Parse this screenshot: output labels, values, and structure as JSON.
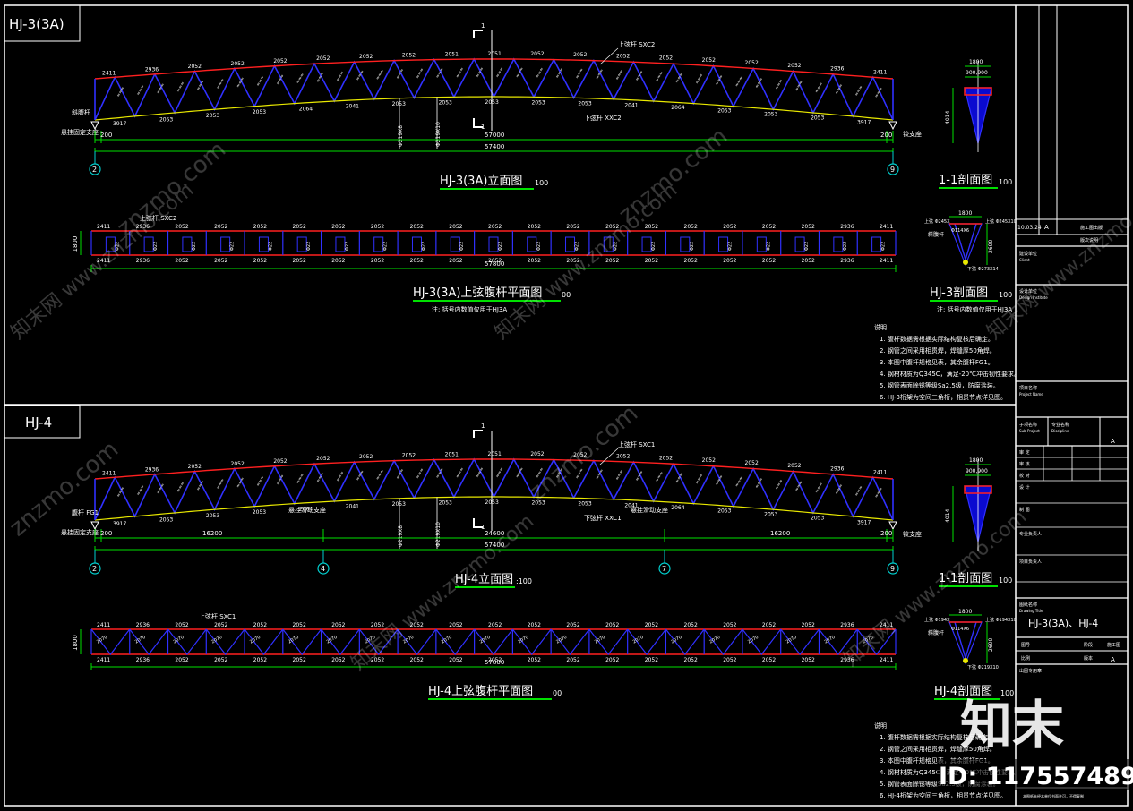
{
  "hj3": {
    "tag": "HJ-3(3A)",
    "elev_title": "HJ-3(3A)立面图",
    "elev_scale": "100",
    "plan_title": "HJ-3(3A)上弦腹杆平面图",
    "plan_scale": "00",
    "plan_note": "注: 括号内数值仅用于HJ3A",
    "sec_title": "1-1剖面图",
    "sec_scale": "100",
    "sec2_title": "HJ-3剖面图",
    "sec2_scale": "100",
    "sec2_note": "注: 括号内数值仅用于HJ3A",
    "top_chord_label": "上弦杆 SXC2",
    "bottom_chord_label": "下弦杆 XXC2",
    "web_label": "斜腹杆",
    "support_left": "悬挂固定支座",
    "support_right": "铰支座",
    "dim_200": "200",
    "dim_57000": "57000",
    "dim_57400": "57400",
    "plan_dim": "57800",
    "plan_height": "1800",
    "axis_left": "2",
    "axis_right": "9",
    "vert1": "Φ219X8",
    "vert2": "Φ219X10",
    "sec_dim1": "1800",
    "sec_dim2": "900,900",
    "sec_height": "4014",
    "sec2_w": "1800",
    "sec2_h": "2600",
    "sec2_l1": "上弦 Φ245X",
    "sec2_l2": "斜腹杆",
    "sec2_l3": "Φ114X6",
    "sec2_l4": "下弦 Φ273X14",
    "sec2_l5": "上弦 Φ245X10",
    "sec_mark": "1"
  },
  "hj4": {
    "tag": "HJ-4",
    "elev_title": "HJ-4立面图",
    "elev_scale": ":100",
    "plan_title": "HJ-4上弦腹杆平面图",
    "plan_scale": "00",
    "sec_title": "1-1剖面图",
    "sec_scale": "100",
    "sec2_title": "HJ-4剖面图",
    "sec2_scale": "100",
    "top_chord_label": "上弦杆 SXC1",
    "bottom_chord_label": "下弦杆 XXC1",
    "web_label": "腹杆 FG1",
    "support_left": "悬挂固定支座",
    "support_mid": "悬挂滑动支座",
    "support_right": "铰支座",
    "dims": [
      "200",
      "16200",
      "24600",
      "16200",
      "200"
    ],
    "dim_57400": "57400",
    "plan_dim": "57800",
    "plan_height": "1800",
    "axes": [
      "2",
      "4",
      "7",
      "9"
    ],
    "sec2_l1": "上弦 Φ194X",
    "sec2_l2": "斜腹杆",
    "sec2_l3": "Φ114X6",
    "sec2_l4": "下弦 Φ219X10",
    "sec2_l5": "上弦 Φ194X10"
  },
  "chord_labels_top": [
    "2411",
    "2936",
    "2052",
    "2052",
    "2052",
    "2052",
    "2052",
    "2052",
    "2051",
    "2051",
    "2052",
    "2052",
    "2052",
    "2052",
    "2052",
    "2052",
    "2052",
    "2936",
    "2411"
  ],
  "chord_labels_bottom": [
    "3917",
    "2053",
    "2053",
    "2053",
    "2064",
    "2041",
    "2053",
    "2053",
    "2053",
    "2053",
    "2053",
    "2041",
    "2064",
    "2053",
    "2053",
    "2053",
    "3917"
  ],
  "plan_labels_top": [
    "2411",
    "2936",
    "2052",
    "2052",
    "2052",
    "2052",
    "2052",
    "2052",
    "2052",
    "2052",
    "2052",
    "2052",
    "2052",
    "2052",
    "2052",
    "2052",
    "2052",
    "2052",
    "2052",
    "2936",
    "2411"
  ],
  "plan_labels_bottom": [
    "2411",
    "2936",
    "2052",
    "2052",
    "2052",
    "2052",
    "2052",
    "2052",
    "2052",
    "2052",
    "2052",
    "2052",
    "2052",
    "2052",
    "2052",
    "2052",
    "2052",
    "2052",
    "2052",
    "2936",
    "2411"
  ],
  "notes_hj3": {
    "head": "说明",
    "items": [
      "1.  腹杆数据需根据实际结构复核后确定。",
      "2.  钢管之间采用相贯焊，焊缝厚50角焊。",
      "3.  本图中腹杆规格见表，其余腹杆FG1。",
      "4.  钢材材质为Q345C，满足-20℃冲击韧性要求。",
      "5.  钢管表面除锈等级Sa2.5级，防腐涂装。",
      "6.  HJ-3桁架为空间三角桁，相贯节点详见图。"
    ]
  },
  "notes_hj4": {
    "head": "说明",
    "items": [
      "1.  腹杆数据需根据实际结构复核后确定。",
      "2.  钢管之间采用相贯焊，焊缝厚50角焊。",
      "3.  本图中腹杆规格见表，其余腹杆FG1。",
      "4.  钢材材质为Q345C，满足-20℃冲击韧性要求。",
      "5.  钢管表面除锈等级Sa2.5级，防腐涂装。",
      "6.  HJ-4桁架为空间三角桁，相贯节点详见图。"
    ]
  },
  "title_block": {
    "date": "10.03.24",
    "rev": "A",
    "rev_desc": "施工图出版",
    "rev_desc2": "版次说明",
    "label_client": "建设单位",
    "label_client_en": "Client",
    "label_design": "设计单位",
    "label_design_en": "Design Institute",
    "label_project": "项目名称",
    "label_project_en": "Project Name",
    "label_subproject": "子项名称",
    "label_subproject_en": "Sub-Project",
    "label_discipline": "专业名称",
    "label_discipline_en": "Discipline",
    "label_approved": "审 定",
    "label_reviewed": "审 核",
    "label_checked": "校 对",
    "label_designed": "设 计",
    "label_drawn": "制 图",
    "label_chief": "专业负责人",
    "label_pm": "项目负责人",
    "label_drawing": "图纸名称",
    "label_drawing_en": "Drawing Title",
    "drawing_title": "HJ-3(3A)、HJ-4",
    "label_no": "图号",
    "label_stage": "阶段",
    "stage": "施工图",
    "label_scale": "比例",
    "label_version": "版本",
    "version": "A",
    "label_status": "出图专用章",
    "footer": "本图纸未经本单位书面许可，不得复制"
  },
  "watermark": {
    "brand": "知末",
    "site": "znzmo.com",
    "site2": "知末网 www.znzmo.com",
    "id": "ID: 1175574893"
  }
}
